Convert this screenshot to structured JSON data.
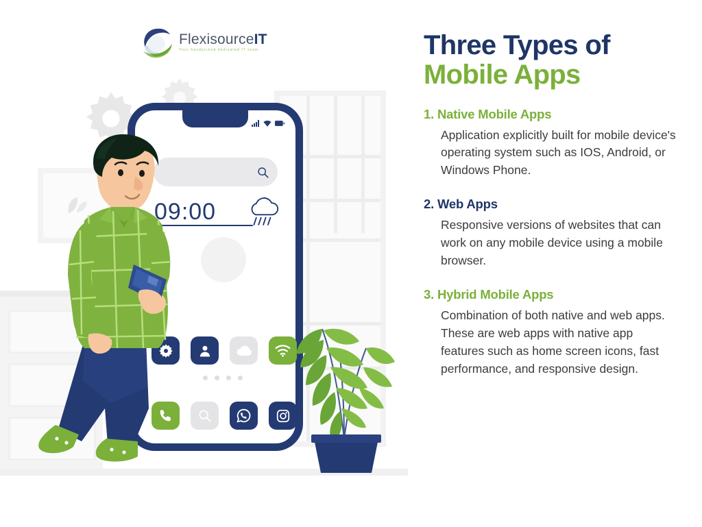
{
  "brand": {
    "name_part1": "Flexisource",
    "name_part2": "IT",
    "tagline": "Your handpicked dedicated IT team.",
    "logo_icon": "circular-swoosh-logo-icon",
    "navy": "#1F3566",
    "green": "#7BB03A",
    "gray": "#E4E4E6"
  },
  "heading": {
    "line1": "Three Types of",
    "line2": "Mobile Apps"
  },
  "items": [
    {
      "number": "1.",
      "title": "Native Mobile Apps",
      "title_color": "green",
      "body": "Application explicitly built for mobile device's operating system such as IOS, Android, or Windows Phone."
    },
    {
      "number": "2.",
      "title": "Web Apps",
      "title_color": "navy",
      "body": "Responsive versions of websites that can work on any mobile device using a mobile browser."
    },
    {
      "number": "3.",
      "title": "Hybrid Mobile Apps",
      "title_color": "green",
      "body": "Combination of both native and web apps. These are web apps with native app features such as home screen icons, fast performance, and responsive design."
    }
  ],
  "phone": {
    "status_icons": [
      "signal-bars-icon",
      "wifi-icon",
      "battery-icon"
    ],
    "search_placeholder": "",
    "search_icon": "search-icon",
    "clock": "09:00",
    "weather_icon": "rain-cloud-icon",
    "page_dots": 4,
    "app_row_1": [
      {
        "icon": "gear-icon",
        "style": "navy"
      },
      {
        "icon": "contact-person-icon",
        "style": "navy"
      },
      {
        "icon": "cloud-icon",
        "style": "gray"
      },
      {
        "icon": "wifi-icon",
        "style": "green"
      }
    ],
    "app_row_2": [
      {
        "icon": "phone-call-icon",
        "style": "green"
      },
      {
        "icon": "search-icon",
        "style": "gray"
      },
      {
        "icon": "whatsapp-icon",
        "style": "navy"
      },
      {
        "icon": "instagram-icon",
        "style": "navy"
      }
    ]
  },
  "scene": {
    "character": "man-holding-smartphone-illustration",
    "plant": "potted-palm-plant",
    "window": "background-window",
    "gears": "decorative-gear-shapes",
    "frame": "wall-picture-frame",
    "cabinet": "background-drawer-cabinet"
  }
}
